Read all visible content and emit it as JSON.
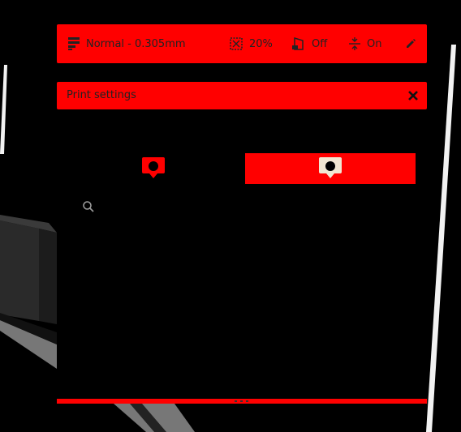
{
  "summary": {
    "profile_label": "Normal - 0.305mm",
    "infill_label": "20%",
    "support_label": "Off",
    "adhesion_label": "On"
  },
  "panel": {
    "title": "Print settings"
  },
  "mode_tabs": {
    "selected": "custom"
  },
  "colors": {
    "accent": "#ff0000",
    "background": "#000000",
    "text_dark": "#222222",
    "icon_light": "#f1e6d2"
  },
  "icons": {
    "profile": "print-profile-icon",
    "infill": "infill-icon",
    "support": "support-icon",
    "adhesion": "adhesion-icon",
    "edit": "pencil-icon",
    "close": "close-icon",
    "recommended": "recommended-mode-icon",
    "custom": "custom-mode-icon",
    "search": "search-icon"
  }
}
